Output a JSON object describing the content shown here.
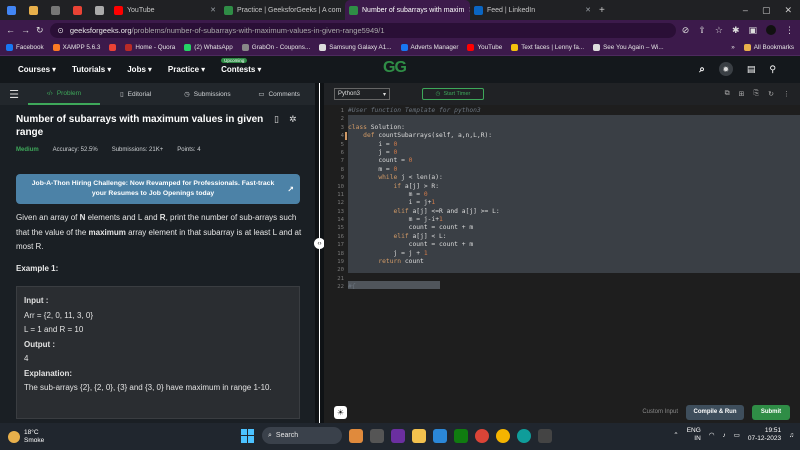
{
  "browser": {
    "tabs": [
      {
        "label": "",
        "icon": "chrome-icon",
        "color": "#4285f4"
      },
      {
        "label": "",
        "icon": "hindi-icon",
        "color": "#e8b04b"
      },
      {
        "label": "",
        "icon": "cc-icon",
        "color": "#777777"
      },
      {
        "label": "",
        "icon": "gmail-icon",
        "color": "#ea4335"
      },
      {
        "label": "",
        "icon": "bookmark-app-icon",
        "color": "#aaaaaa"
      },
      {
        "label": "YouTube",
        "icon": "youtube-icon",
        "color": "#ff0000"
      },
      {
        "label": "Practice | GeeksforGeeks | A com",
        "icon": "gfg-icon",
        "color": "#2f8d46"
      },
      {
        "label": "Number of subarrays with maxim",
        "icon": "gfg-icon",
        "color": "#2f8d46",
        "active": true
      },
      {
        "label": "Feed | LinkedIn",
        "icon": "linkedin-icon",
        "color": "#0a66c2"
      }
    ],
    "new_tab": "+",
    "url_host": "geeksforgeeks.org",
    "url_path": "/problems/number-of-subarrays-with-maximum-values-in-given-range5949/1",
    "bookmarks": [
      {
        "label": "Facebook",
        "color": "#1877f2"
      },
      {
        "label": "XAMPP 5.6.3",
        "color": "#fb7a24"
      },
      {
        "label": "",
        "color": "#ea4335"
      },
      {
        "label": "Home - Quora",
        "color": "#b92b27"
      },
      {
        "label": "(2) WhatsApp",
        "color": "#25d366"
      },
      {
        "label": "GrabOn - Coupons...",
        "color": "#888888"
      },
      {
        "label": "Samsung Galaxy A1...",
        "color": "#dddddd"
      },
      {
        "label": "Adverts Manager",
        "color": "#1877f2"
      },
      {
        "label": "YouTube",
        "color": "#ff0000"
      },
      {
        "label": "Text faces | Lenny fa...",
        "color": "#f4c20d"
      },
      {
        "label": "See You Again – Wi...",
        "color": "#dddddd"
      }
    ],
    "bookmarks_more": "»",
    "all_bookmarks": "All Bookmarks"
  },
  "gfg_nav": {
    "items": [
      "Courses",
      "Tutorials",
      "Jobs",
      "Practice",
      "Contests"
    ],
    "upcoming_badge": "Upcoming",
    "logo": "GG"
  },
  "left": {
    "tabs": [
      "Problem",
      "Editorial",
      "Submissions",
      "Comments"
    ],
    "title": "Number of subarrays with maximum values in given range",
    "difficulty": "Medium",
    "accuracy": "Accuracy: 52.5%",
    "submissions": "Submissions: 21K+",
    "points": "Points: 4",
    "banner": "Job-A-Thon Hiring Challenge: Now Revamped for Professionals. Fast-track your Resumes to Job Openings today",
    "desc_a": "Given an array of ",
    "desc_n": "N",
    "desc_b": " elements and L and ",
    "desc_r": "R",
    "desc_c": ", print the number of sub-arrays such that the value of the ",
    "desc_max": "maximum",
    "desc_d": " array element in that subarray is at least L and at most R.",
    "example_heading": "Example 1:",
    "input_label": "Input :",
    "input_arr": "Arr = {2, 0, 11, 3, 0}",
    "input_lr": "L = 1 and R = 10",
    "output_label": "Output :",
    "output_val": "4",
    "expl_label": "Explanation:",
    "expl_text": "The sub-arrays {2}, {2, 0}, {3} and {3, 0} have maximum in range 1-10."
  },
  "editor": {
    "language": "Python3",
    "timer": "Start Timer",
    "lines": [
      "#User function Template for python3",
      "",
      "class Solution:",
      "    def countSubarrays(self, a,n,L,R):",
      "        i = 0",
      "        j = 0",
      "        count = 0",
      "        m = 0",
      "        while j < len(a):",
      "            if a[j] > R:",
      "                m = 0",
      "                i = j+1",
      "            elif a[j] <=R and a[j] >= L:",
      "                m = j-i+1",
      "                count = count + m",
      "            elif a[j] < L:",
      "                count = count + m",
      "            j = j + 1",
      "        return count",
      "",
      "",
      "#{"
    ],
    "custom_input": "Custom Input",
    "compile": "Compile & Run",
    "submit": "Submit"
  },
  "taskbar": {
    "temp": "18°C",
    "weather": "Smoke",
    "search": "Search",
    "lang": "ENG",
    "region": "IN",
    "time": "19:51",
    "date": "07-12-2023"
  }
}
